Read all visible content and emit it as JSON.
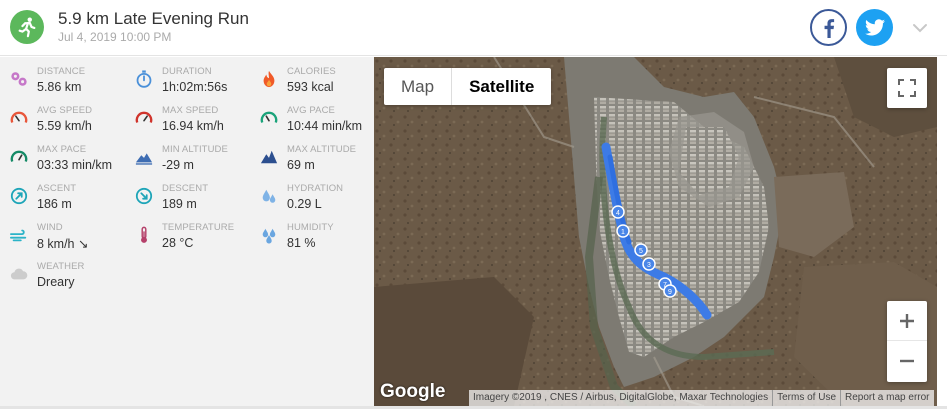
{
  "activity": {
    "title": "5.9 km Late Evening Run",
    "datetime": "Jul 4, 2019 10:00 PM",
    "icon": "running-person-icon"
  },
  "social": {
    "facebook_icon": "facebook-icon",
    "twitter_icon": "twitter-icon"
  },
  "stats": [
    {
      "id": "distance",
      "label": "DISTANCE",
      "value": "5.86 km",
      "icon": "distance-icon",
      "color": "#c678c9"
    },
    {
      "id": "duration",
      "label": "DURATION",
      "value": "1h:02m:56s",
      "icon": "stopwatch-icon",
      "color": "#4a90d9"
    },
    {
      "id": "calories",
      "label": "CALORIES",
      "value": "593 kcal",
      "icon": "flame-icon",
      "color": "#f05a28"
    },
    {
      "id": "avg-speed",
      "label": "AVG SPEED",
      "value": "5.59 km/h",
      "icon": "speedometer-icon",
      "color": "#e8563a"
    },
    {
      "id": "max-speed",
      "label": "MAX SPEED",
      "value": "16.94 km/h",
      "icon": "speedometer-icon",
      "color": "#d0342c"
    },
    {
      "id": "avg-pace",
      "label": "AVG PACE",
      "value": "10:44 min/km",
      "icon": "pace-gauge-icon",
      "color": "#1aa37a"
    },
    {
      "id": "max-pace",
      "label": "MAX PACE",
      "value": "03:33 min/km",
      "icon": "pace-gauge-icon",
      "color": "#158a66"
    },
    {
      "id": "min-altitude",
      "label": "MIN ALTITUDE",
      "value": "-29 m",
      "icon": "mountain-icon",
      "color": "#3e6db3"
    },
    {
      "id": "max-altitude",
      "label": "MAX ALTITUDE",
      "value": "69 m",
      "icon": "mountain-icon",
      "color": "#2c4f8f"
    },
    {
      "id": "ascent",
      "label": "ASCENT",
      "value": "186 m",
      "icon": "ascent-icon",
      "color": "#1ea5b8"
    },
    {
      "id": "descent",
      "label": "DESCENT",
      "value": "189 m",
      "icon": "descent-icon",
      "color": "#1ea5b8"
    },
    {
      "id": "hydration",
      "label": "HYDRATION",
      "value": "0.29 L",
      "icon": "water-drops-icon",
      "color": "#7fb3e6"
    },
    {
      "id": "wind",
      "label": "WIND",
      "value": "8 km/h ↘",
      "icon": "wind-icon",
      "color": "#2bb3c7"
    },
    {
      "id": "temperature",
      "label": "TEMPERATURE",
      "value": "28 °C",
      "icon": "thermometer-icon",
      "color": "#b5406a"
    },
    {
      "id": "humidity",
      "label": "HUMIDITY",
      "value": "81 %",
      "icon": "humidity-drops-icon",
      "color": "#6aa6e0"
    },
    {
      "id": "weather",
      "label": "WEATHER",
      "value": "Dreary",
      "icon": "cloud-icon",
      "color": "#cccccc"
    }
  ],
  "map": {
    "type_map_label": "Map",
    "type_satellite_label": "Satellite",
    "selected_type": "Satellite",
    "zoom_in_label": "+",
    "zoom_out_label": "−",
    "google_label": "Google",
    "imagery_credit": "Imagery ©2019 , CNES / Airbus, DigitalGlobe, Maxar Technologies",
    "terms_label": "Terms of Use",
    "report_label": "Report a map error",
    "route_color": "#3d7be6",
    "markers": [
      "4",
      "1",
      "5",
      "3",
      "7",
      "9"
    ]
  }
}
